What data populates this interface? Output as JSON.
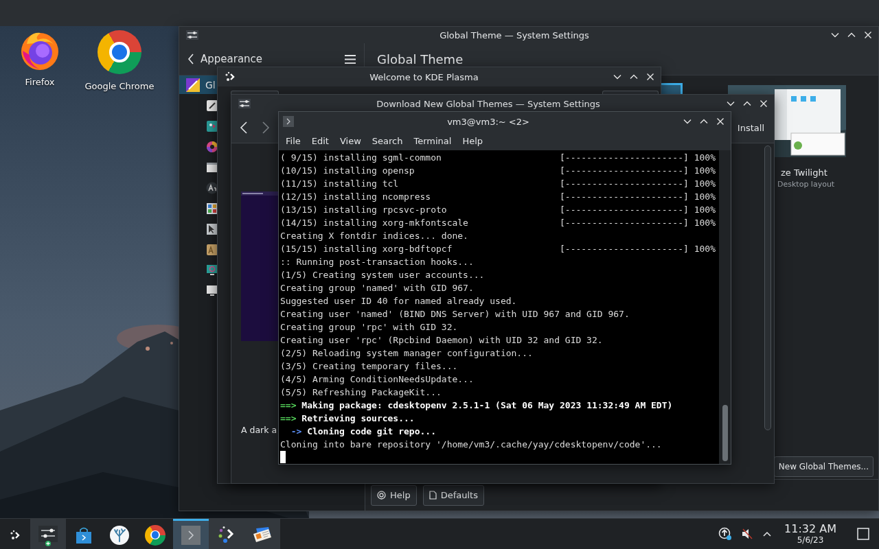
{
  "desktop": {
    "icons": [
      {
        "label": "Firefox",
        "kind": "firefox"
      },
      {
        "label": "Google Chrome",
        "kind": "chrome"
      }
    ]
  },
  "settings_window": {
    "title": "Global Theme — System Settings",
    "back_label": "Appearance",
    "page_title": "Global Theme",
    "sidebar": {
      "items": [
        {
          "label": "Gl",
          "selected": true,
          "children": [
            {
              "kind": "brush"
            },
            {
              "kind": "teal-dots"
            },
            {
              "kind": "color-wheel"
            },
            {
              "kind": "window"
            },
            {
              "kind": "font"
            },
            {
              "kind": "tiles"
            },
            {
              "kind": "cursor"
            },
            {
              "kind": "font-gold"
            },
            {
              "kind": "teal-monitor"
            },
            {
              "kind": "monitor"
            }
          ]
        }
      ]
    },
    "themes": [
      {
        "selected": true
      },
      {
        "name": "ze Twilight",
        "subtitle": "Desktop layout",
        "selected": false
      }
    ],
    "get_new_button": "New Global Themes...",
    "footer_buttons": [
      {
        "label": "Help",
        "kind": "help"
      },
      {
        "label": "Defaults",
        "kind": "defaults"
      }
    ]
  },
  "welcome_window": {
    "title": "Welcome to KDE Plasma"
  },
  "download_window": {
    "title": "Download New Global Themes — System Settings",
    "install_button": "Install",
    "description": "A dark a"
  },
  "terminal_window": {
    "title": "vm3@vm3:~ <2>",
    "menu": [
      "File",
      "Edit",
      "View",
      "Search",
      "Terminal",
      "Help"
    ],
    "lines": [
      {
        "kind": "plain",
        "text": "( 9/15) installing sgml-common",
        "progress": "[----------------------] 100%"
      },
      {
        "kind": "plain",
        "text": "(10/15) installing opensp",
        "progress": "[----------------------] 100%"
      },
      {
        "kind": "plain",
        "text": "(11/15) installing tcl",
        "progress": "[----------------------] 100%"
      },
      {
        "kind": "plain",
        "text": "(12/15) installing ncompress",
        "progress": "[----------------------] 100%"
      },
      {
        "kind": "plain",
        "text": "(13/15) installing rpcsvc-proto",
        "progress": "[----------------------] 100%"
      },
      {
        "kind": "plain",
        "text": "(14/15) installing xorg-mkfontscale",
        "progress": "[----------------------] 100%"
      },
      {
        "kind": "plain",
        "text": "Creating X fontdir indices... done."
      },
      {
        "kind": "plain",
        "text": "(15/15) installing xorg-bdftopcf",
        "progress": "[----------------------] 100%"
      },
      {
        "kind": "plain",
        "text": ":: Running post-transaction hooks..."
      },
      {
        "kind": "plain",
        "text": "(1/5) Creating system user accounts..."
      },
      {
        "kind": "plain",
        "text": "Creating group 'named' with GID 967."
      },
      {
        "kind": "plain",
        "text": "Suggested user ID 40 for named already used."
      },
      {
        "kind": "plain",
        "text": "Creating user 'named' (BIND DNS Server) with UID 967 and GID 967."
      },
      {
        "kind": "plain",
        "text": "Creating group 'rpc' with GID 32."
      },
      {
        "kind": "plain",
        "text": "Creating user 'rpc' (Rpcbind Daemon) with UID 32 and GID 32."
      },
      {
        "kind": "plain",
        "text": "(2/5) Reloading system manager configuration..."
      },
      {
        "kind": "plain",
        "text": "(3/5) Creating temporary files..."
      },
      {
        "kind": "plain",
        "text": "(4/5) Arming ConditionNeedsUpdate..."
      },
      {
        "kind": "plain",
        "text": "(5/5) Refreshing PackageKit..."
      },
      {
        "kind": "header",
        "marker": "==>",
        "text": "Making package: cdesktopenv 2.5.1-1 (Sat 06 May 2023 11:32:49 AM EDT)"
      },
      {
        "kind": "header",
        "marker": "==>",
        "text": "Retrieving sources..."
      },
      {
        "kind": "sub",
        "marker": "->",
        "text": "Cloning code git repo..."
      },
      {
        "kind": "plain",
        "text": "Cloning into bare repository '/home/vm3/.cache/yay/cdesktopenv/code'..."
      },
      {
        "kind": "cursor"
      }
    ]
  },
  "taskbar": {
    "tasks": [
      {
        "kind": "launcher",
        "running": false,
        "active": false
      },
      {
        "kind": "settings",
        "running": true,
        "active": false
      },
      {
        "kind": "store",
        "running": false,
        "active": false
      },
      {
        "kind": "coral",
        "running": false,
        "active": false
      },
      {
        "kind": "chrome",
        "running": false,
        "active": false
      },
      {
        "kind": "terminal",
        "running": true,
        "active": true
      },
      {
        "kind": "welcome",
        "running": true,
        "active": false
      },
      {
        "kind": "card",
        "running": true,
        "active": false
      }
    ],
    "clock": {
      "time": "11:32 AM",
      "date": "5/6/23"
    }
  }
}
